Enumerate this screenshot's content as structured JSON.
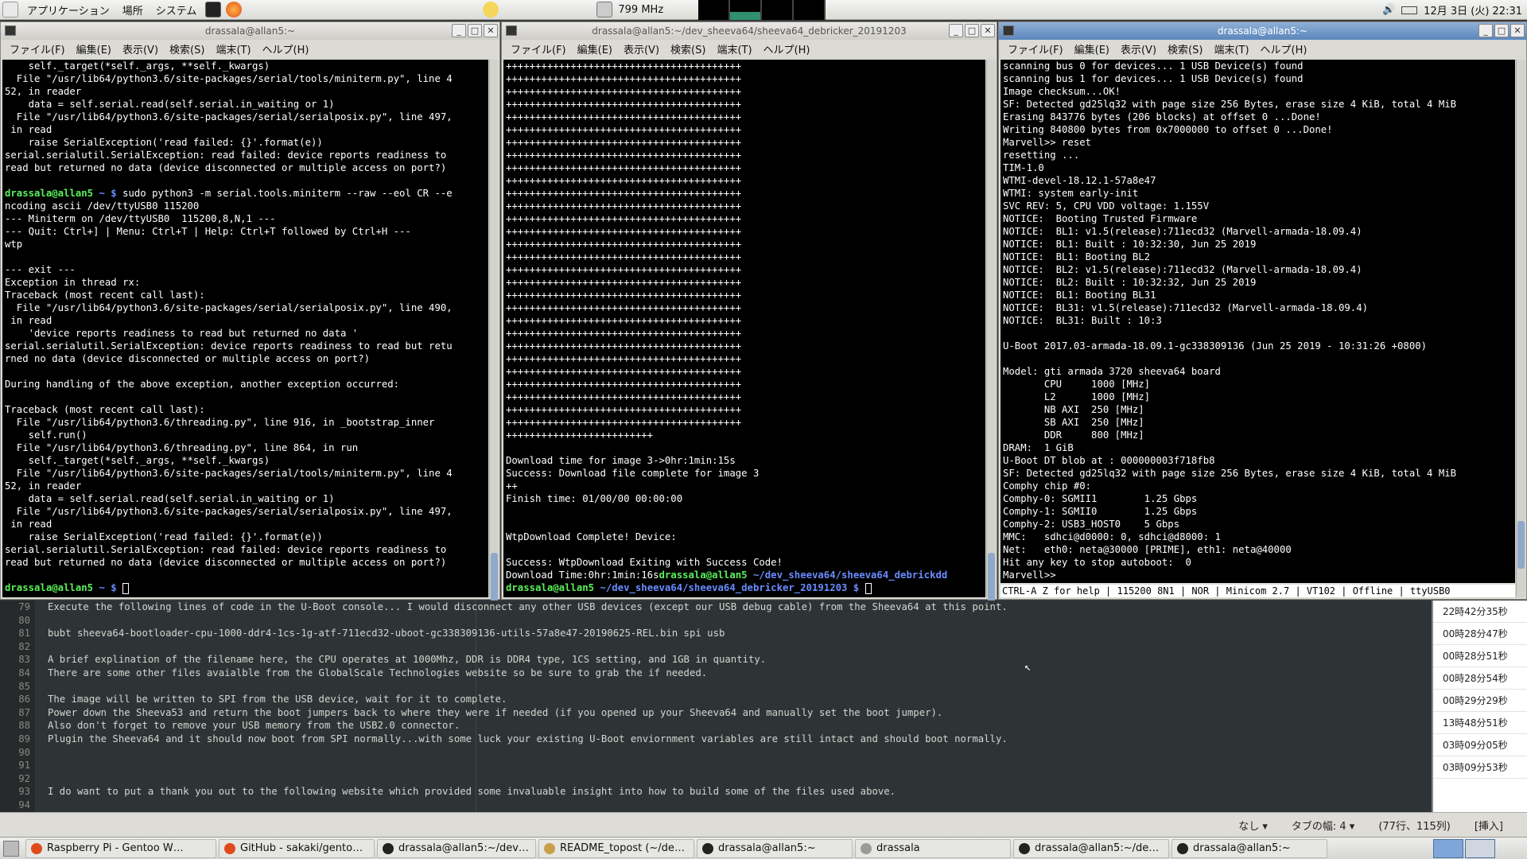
{
  "top_panel": {
    "applications": "アプリケーション",
    "places": "場所",
    "system": "システム",
    "cpu_freq": "799 MHz",
    "clock": "12月 3日 (火) 22:31"
  },
  "window_left": {
    "title": "drassala@allan5:~",
    "menu": [
      "ファイル(F)",
      "編集(E)",
      "表示(V)",
      "検索(S)",
      "端末(T)",
      "ヘルプ(H)"
    ],
    "lines": [
      "    self._target(*self._args, **self._kwargs)",
      "  File \"/usr/lib64/python3.6/site-packages/serial/tools/miniterm.py\", line 4",
      "52, in reader",
      "    data = self.serial.read(self.serial.in_waiting or 1)",
      "  File \"/usr/lib64/python3.6/site-packages/serial/serialposix.py\", line 497,",
      " in read",
      "    raise SerialException('read failed: {}'.format(e))",
      "serial.serialutil.SerialException: read failed: device reports readiness to",
      "read but returned no data (device disconnected or multiple access on port?)",
      "",
      "drassala@allan5 ~ $ sudo python3 -m serial.tools.miniterm --raw --eol CR --e",
      "ncoding ascii /dev/ttyUSB0 115200",
      "--- Miniterm on /dev/ttyUSB0  115200,8,N,1 ---",
      "--- Quit: Ctrl+] | Menu: Ctrl+T | Help: Ctrl+T followed by Ctrl+H ---",
      "wtp",
      "",
      "--- exit ---",
      "Exception in thread rx:",
      "Traceback (most recent call last):",
      "  File \"/usr/lib64/python3.6/site-packages/serial/serialposix.py\", line 490,",
      " in read",
      "    'device reports readiness to read but returned no data '",
      "serial.serialutil.SerialException: device reports readiness to read but retu",
      "rned no data (device disconnected or multiple access on port?)",
      "",
      "During handling of the above exception, another exception occurred:",
      "",
      "Traceback (most recent call last):",
      "  File \"/usr/lib64/python3.6/threading.py\", line 916, in _bootstrap_inner",
      "    self.run()",
      "  File \"/usr/lib64/python3.6/threading.py\", line 864, in run",
      "    self._target(*self._args, **self._kwargs)",
      "  File \"/usr/lib64/python3.6/site-packages/serial/tools/miniterm.py\", line 4",
      "52, in reader",
      "    data = self.serial.read(self.serial.in_waiting or 1)",
      "  File \"/usr/lib64/python3.6/site-packages/serial/serialposix.py\", line 497,",
      " in read",
      "    raise SerialException('read failed: {}'.format(e))",
      "serial.serialutil.SerialException: read failed: device reports readiness to",
      "read but returned no data (device disconnected or multiple access on port?)",
      ""
    ],
    "prompt_user": "drassala@allan5",
    "prompt_path": " ~ $ "
  },
  "window_mid": {
    "title": "drassala@allan5:~/dev_sheeva64/sheeva64_debricker_20191203",
    "menu": [
      "ファイル(F)",
      "編集(E)",
      "表示(V)",
      "検索(S)",
      "端末(T)",
      "ヘルプ(H)"
    ],
    "plus_line": "++++++++++++++++++++++++++++++++++++++++",
    "plus_count": 29,
    "short_plus": "+++++++++++++++++++++++++",
    "lines": [
      "",
      "Download time for image 3->0hr:1min:15s",
      "Success: Download file complete for image 3",
      "++",
      "Finish time: 01/00/00 00:00:00",
      "",
      "",
      "WtpDownload Complete! Device:",
      "",
      "Success: WtpDownload Exiting with Success Code!"
    ],
    "dl_line_text": "Download Time:0hr:1min:16s",
    "dl_line_user": "drassala@allan5",
    "dl_line_path": " ~/dev_sheeva64/sheeva64_debrickdd",
    "prompt_user": "drassala@allan5",
    "prompt_path": " ~/dev_sheeva64/sheeva64_debricker_20191203 $ "
  },
  "window_right": {
    "title": "drassala@allan5:~",
    "menu": [
      "ファイル(F)",
      "編集(E)",
      "表示(V)",
      "検索(S)",
      "端末(T)",
      "ヘルプ(H)"
    ],
    "lines": [
      "scanning bus 0 for devices... 1 USB Device(s) found",
      "scanning bus 1 for devices... 1 USB Device(s) found",
      "Image checksum...OK!",
      "SF: Detected gd25lq32 with page size 256 Bytes, erase size 4 KiB, total 4 MiB",
      "Erasing 843776 bytes (206 blocks) at offset 0 ...Done!",
      "Writing 840800 bytes from 0x7000000 to offset 0 ...Done!",
      "Marvell>> reset",
      "resetting ...",
      "TIM-1.0",
      "WTMI-devel-18.12.1-57a8e47",
      "WTMI: system early-init",
      "SVC REV: 5, CPU VDD voltage: 1.155V",
      "NOTICE:  Booting Trusted Firmware",
      "NOTICE:  BL1: v1.5(release):711ecd32 (Marvell-armada-18.09.4)",
      "NOTICE:  BL1: Built : 10:32:30, Jun 25 2019",
      "NOTICE:  BL1: Booting BL2",
      "NOTICE:  BL2: v1.5(release):711ecd32 (Marvell-armada-18.09.4)",
      "NOTICE:  BL2: Built : 10:32:32, Jun 25 2019",
      "NOTICE:  BL1: Booting BL31",
      "NOTICE:  BL31: v1.5(release):711ecd32 (Marvell-armada-18.09.4)",
      "NOTICE:  BL31: Built : 10:3",
      "",
      "U-Boot 2017.03-armada-18.09.1-gc338309136 (Jun 25 2019 - 10:31:26 +0800)",
      "",
      "Model: gti armada 3720 sheeva64 board",
      "       CPU     1000 [MHz]",
      "       L2      1000 [MHz]",
      "       NB AXI  250 [MHz]",
      "       SB AXI  250 [MHz]",
      "       DDR     800 [MHz]",
      "DRAM:  1 GiB",
      "U-Boot DT blob at : 000000003f718fb8",
      "SF: Detected gd25lq32 with page size 256 Bytes, erase size 4 KiB, total 4 MiB",
      "Comphy chip #0:",
      "Comphy-0: SGMII1        1.25 Gbps",
      "Comphy-1: SGMII0        1.25 Gbps",
      "Comphy-2: USB3_HOST0    5 Gbps",
      "MMC:   sdhci@d0000: 0, sdhci@d8000: 1",
      "Net:   eth0: neta@30000 [PRIME], eth1: neta@40000",
      "Hit any key to stop autoboot:  0",
      "Marvell>> "
    ],
    "status": "CTRL-A Z for help | 115200 8N1 | NOR | Minicom 2.7 | VT102 | Offline | ttyUSB0"
  },
  "editor": {
    "line_numbers": [
      "79",
      "80",
      "81",
      "82",
      "83",
      "84",
      "85",
      "86",
      "87",
      "88",
      "89",
      "90",
      "91",
      "92",
      "93",
      "94"
    ],
    "lines": [
      "Execute the following lines of code in the U-Boot console... I would disconnect any other USB devices (except our USB debug cable) from the Sheeva64 at this point.",
      "",
      "bubt sheeva64-bootloader-cpu-1000-ddr4-1cs-1g-atf-711ecd32-uboot-gc338309136-utils-57a8e47-20190625-REL.bin spi usb",
      "",
      "A brief explination of the filename here, the CPU operates at 1000Mhz, DDR is DDR4 type, 1CS setting, and 1GB in quantity.",
      "There are some other files avaialble from the GlobalScale Technologies website so be sure to grab the if needed.",
      "",
      "The image will be written to SPI from the USB device, wait for it to complete.",
      "Power down the Sheeva53 and return the boot jumpers back to where they were if needed (if you opened up your Sheeva64 and manually set the boot jumper).",
      "Also don't forget to remove your USB memory from the USB2.0 connector.",
      "Plugin the Sheeva64 and it should now boot from SPI normally...with some luck your existing U-Boot enviornment variables are still intact and should boot normally.",
      "",
      "",
      "",
      "I do want to put a thank you out to the following website which provided some invaluable insight into how to build some of the files used above.",
      ""
    ],
    "side_items": [
      "22時42分35秒",
      "00時28分47秒",
      "00時28分51秒",
      "00時28分54秒",
      "00時29分29秒",
      "13時48分51秒",
      "03時09分05秒",
      "03時09分53秒"
    ],
    "status_lang": "なし",
    "status_tab": "タブの幅: 4",
    "status_pos": "(77行、115列)",
    "status_mode": "[挿入]"
  },
  "taskbar": {
    "tasks": [
      {
        "label": "Raspberry Pi - Gentoo W…",
        "color": "#e04a1a"
      },
      {
        "label": "GitHub - sakaki/gentoo-…",
        "color": "#e04a1a"
      },
      {
        "label": "drassala@allan5:~/dev_r…",
        "color": "#222222"
      },
      {
        "label": "README_topost (~/dev…",
        "color": "#c9a04a"
      },
      {
        "label": "drassala@allan5:~",
        "color": "#222222"
      },
      {
        "label": "drassala",
        "color": "#9a9a9a"
      },
      {
        "label": "drassala@allan5:~/dev_s…",
        "color": "#222222"
      },
      {
        "label": "drassala@allan5:~",
        "color": "#222222"
      }
    ]
  }
}
